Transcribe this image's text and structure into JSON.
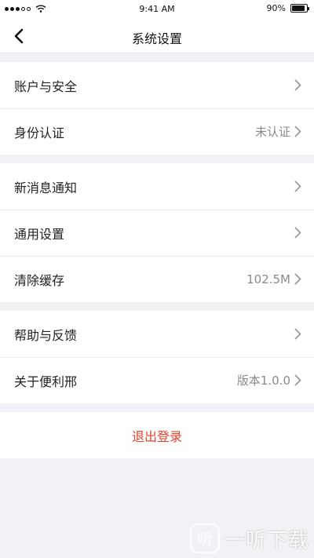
{
  "status_bar": {
    "time": "9:41 AM",
    "battery_text": "90%",
    "battery_level": 0.9
  },
  "nav": {
    "title": "系统设置",
    "back_icon": "chevron-left-icon"
  },
  "groups": [
    {
      "items": [
        {
          "label": "账户与安全",
          "value": ""
        },
        {
          "label": "身份认证",
          "value": "未认证"
        }
      ]
    },
    {
      "items": [
        {
          "label": "新消息通知",
          "value": ""
        },
        {
          "label": "通用设置",
          "value": ""
        },
        {
          "label": "清除缓存",
          "value": "102.5M"
        }
      ]
    },
    {
      "items": [
        {
          "label": "帮助与反馈",
          "value": ""
        },
        {
          "label": "关于便利邢",
          "value": "版本1.0.0"
        }
      ]
    }
  ],
  "logout": {
    "label": "退出登录",
    "color": "#e8402a"
  },
  "watermark": {
    "text": "一听下载",
    "logo_text": "听"
  }
}
